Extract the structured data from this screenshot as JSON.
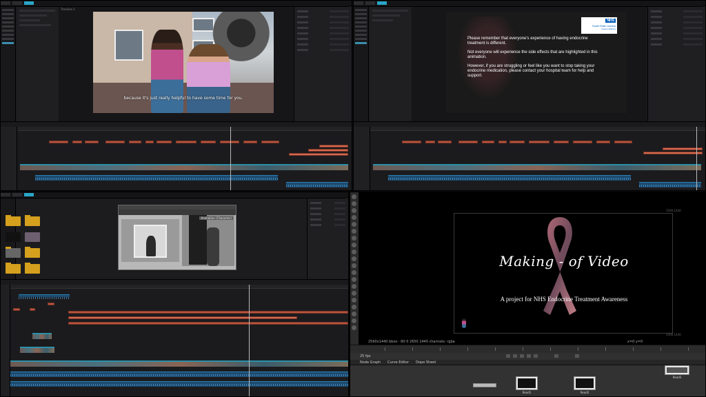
{
  "top_left": {
    "subtitle": "because it's just really helpful to have some time for you.",
    "viewer_label": "Timeline 1"
  },
  "top_right": {
    "nhs_badge": "NHS",
    "nhs_org": "South East London",
    "nhs_org_sub": "Cancer Alliance",
    "paragraphs": [
      "Please remember that everyone's experience of having endocrine treatment is different.",
      "Not everyone will experience the side effects that are highlighted in this animation.",
      "However, if you are struggling or feel like you want to stop taking your endocrine medication,  please contact your hospital team for help and support."
    ]
  },
  "bottom_left": {
    "maya_tag": "Animation (Character)"
  },
  "bottom_right": {
    "title": "Making - of Video",
    "subtitle": "A project for NHS Endocrine Treatment Awareness",
    "res_top": "2560,1440",
    "res_bottom": "2560,1440",
    "info": "2560x1440  bbox: -90 0 2650 1440 channels: rgba",
    "xy": "x=0 y=0",
    "fps": "25 fps",
    "tabs": [
      "Node Graph",
      "Curve Editor",
      "Dope Sheet"
    ],
    "nodes": [
      "Read1",
      "Read2",
      "Read3"
    ]
  }
}
